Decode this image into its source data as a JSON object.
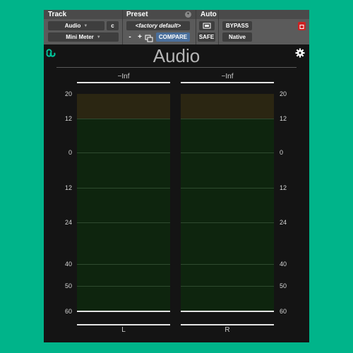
{
  "header": {
    "track": {
      "label": "Track",
      "name": "Audio",
      "channel": "c",
      "plugin": "Mini Meter"
    },
    "preset": {
      "label": "Preset",
      "name": "<factory default>",
      "minus": "-",
      "plus": "+",
      "compare": "COMPARE"
    },
    "auto": {
      "label": "Auto",
      "safe": "SAFE"
    },
    "bypass": "BYPASS",
    "native": "Native"
  },
  "plugin": {
    "title": "Audio",
    "channels": [
      {
        "name": "L",
        "peak": "−Inf"
      },
      {
        "name": "R",
        "peak": "−Inf"
      }
    ],
    "scale": [
      "20",
      "12",
      "0",
      "12",
      "24",
      "40",
      "50",
      "60"
    ]
  },
  "colors": {
    "background": "#00b48a",
    "meter_green": "#0e250e",
    "meter_hot": "#2b2612",
    "header": "#5b5b5b",
    "close_button": "#cc2222"
  }
}
